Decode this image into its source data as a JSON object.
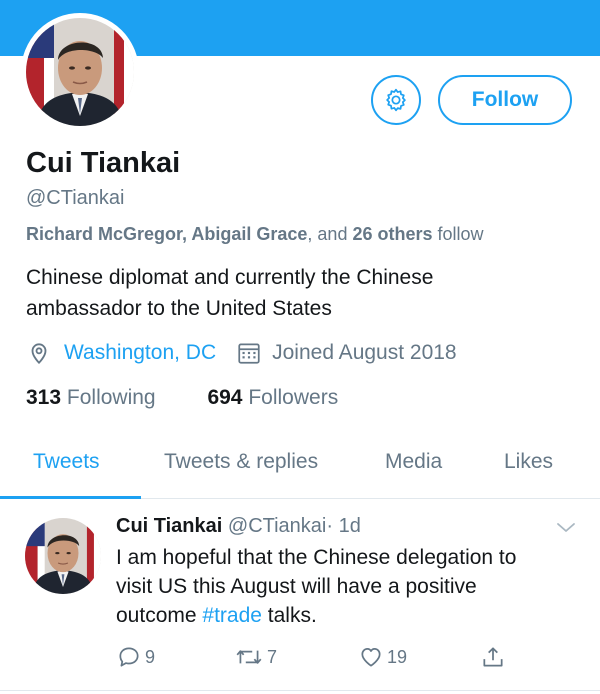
{
  "profile": {
    "name": "Cui Tiankai",
    "handle": "@CTiankai",
    "follow_label": "Follow",
    "followed_by": {
      "names": "Richard McGregor, Abigail Grace",
      "and": ", and ",
      "others": "26 others",
      "suffix": " follow"
    },
    "bio_line1": "Chinese diplomat and currently the Chinese",
    "bio_line2": "ambassador to the United States",
    "location": "Washington, DC",
    "joined": "Joined August 2018",
    "following_count": "313",
    "following_label": "Following",
    "followers_count": "694",
    "followers_label": "Followers"
  },
  "tabs": [
    {
      "label": "Tweets",
      "active": true
    },
    {
      "label": "Tweets & replies",
      "active": false
    },
    {
      "label": "Media",
      "active": false
    },
    {
      "label": "Likes",
      "active": false
    }
  ],
  "tweet": {
    "name": "Cui Tiankai",
    "handle": "@CTiankai",
    "sep": "·",
    "time": "1d",
    "line1": "I am hopeful that the Chinese delegation to",
    "line2": "visit US this August will have a positive",
    "line3_pre": "outcome ",
    "hashtag": "#trade",
    "line3_post": " talks.",
    "replies": "9",
    "retweets": "7",
    "likes": "19"
  },
  "colors": {
    "accent": "#1da1f2",
    "secondary_text": "#657786",
    "primary_text": "#14171a"
  },
  "icons": [
    "gear-icon",
    "location-pin-icon",
    "calendar-icon",
    "chevron-down-icon",
    "reply-icon",
    "retweet-icon",
    "like-icon",
    "share-icon"
  ]
}
